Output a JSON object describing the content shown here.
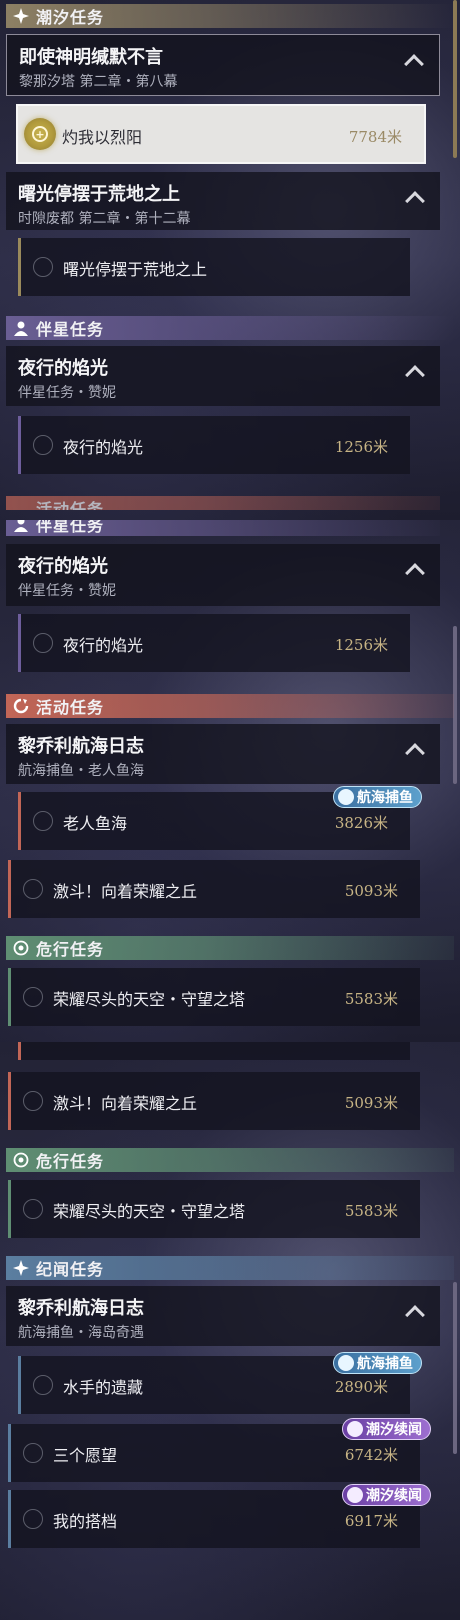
{
  "panel1": {
    "cat_tide": "潮汐任务",
    "group1": {
      "title": "即使神明缄默不言",
      "sub": "黎那汐塔 第二章・第八幕"
    },
    "item1": {
      "name": "灼我以烈阳",
      "dist": "7784米"
    },
    "group2": {
      "title": "曙光停摆于荒地之上",
      "sub": "时隙废都 第二章・第十二幕"
    },
    "item2": {
      "name": "曙光停摆于荒地之上",
      "dist": ""
    },
    "cat_comp": "伴星任务",
    "group3": {
      "title": "夜行的焰光",
      "sub": "伴星任务・赞妮"
    },
    "item3": {
      "name": "夜行的焰光",
      "dist": "1256米"
    },
    "peek_cat": "活动任务"
  },
  "panel2": {
    "peek_cat": "伴星任务",
    "group1": {
      "title": "夜行的焰光",
      "sub": "伴星任务・赞妮"
    },
    "item1": {
      "name": "夜行的焰光",
      "dist": "1256米"
    },
    "cat_event": "活动任务",
    "group2": {
      "title": "黎乔利航海日志",
      "sub": "航海捕鱼・老人鱼海"
    },
    "item2": {
      "name": "老人鱼海",
      "dist": "3826米",
      "tag": "航海捕鱼"
    },
    "item3": {
      "name": "激斗！向着荣耀之丘",
      "dist": "5093米"
    },
    "cat_danger": "危行任务",
    "item4": {
      "name": "荣耀尽头的天空・守望之塔",
      "dist": "5583米"
    }
  },
  "panel3": {
    "item1": {
      "name": "激斗！向着荣耀之丘",
      "dist": "5093米"
    },
    "cat_danger": "危行任务",
    "item2": {
      "name": "荣耀尽头的天空・守望之塔",
      "dist": "5583米"
    },
    "cat_lore": "纪闻任务",
    "group1": {
      "title": "黎乔利航海日志",
      "sub": "航海捕鱼・海岛奇遇"
    },
    "item3": {
      "name": "水手的遗藏",
      "dist": "2890米",
      "tag": "航海捕鱼"
    },
    "item4": {
      "name": "三个愿望",
      "dist": "6742米",
      "tag": "潮汐续闻"
    },
    "item5": {
      "name": "我的搭档",
      "dist": "6917米",
      "tag": "潮汐续闻"
    }
  },
  "colors": {
    "tide": "#8d8064",
    "companion": "#6a5e94",
    "event": "#c26657",
    "danger": "#5f8e73",
    "lore": "#5b7ea0",
    "distance": "#c7b485"
  },
  "icons": {
    "tide": "sparkle-icon",
    "companion": "person-icon",
    "event": "swirl-icon",
    "danger": "warning-eye-icon",
    "lore": "sparkle-icon",
    "collapse": "chevron-up-icon",
    "track": "track-target-icon",
    "fishing_tag": "fishing-icon",
    "tide_tag": "tide-story-icon"
  }
}
